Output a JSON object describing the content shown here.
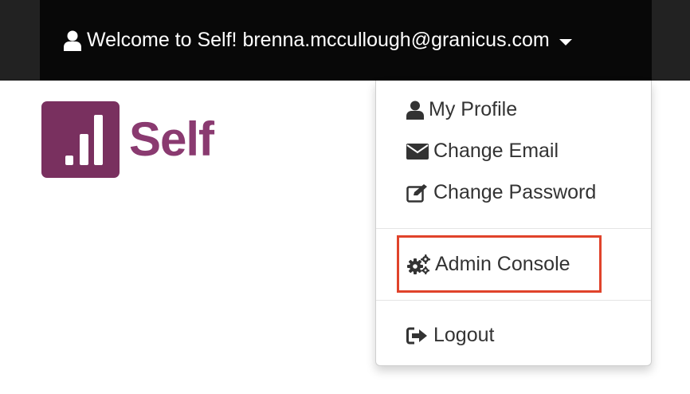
{
  "navbar": {
    "welcome_text": "Welcome to Self! brenna.mccullough@granicus.com",
    "icon": "user-icon",
    "caret_icon": "caret-down-icon",
    "background": "#222222",
    "toggle_background": "#080808"
  },
  "logo": {
    "text": "Self",
    "color": "#79305f"
  },
  "menu": {
    "items": [
      {
        "label": "My Profile",
        "icon": "user-icon"
      },
      {
        "label": "Change Email",
        "icon": "envelope-icon"
      },
      {
        "label": "Change Password",
        "icon": "edit-icon"
      },
      {
        "label": "Admin Console",
        "icon": "cogs-icon",
        "highlighted": true
      },
      {
        "label": "Logout",
        "icon": "sign-out-icon"
      }
    ],
    "highlight_color": "#e0432b"
  }
}
